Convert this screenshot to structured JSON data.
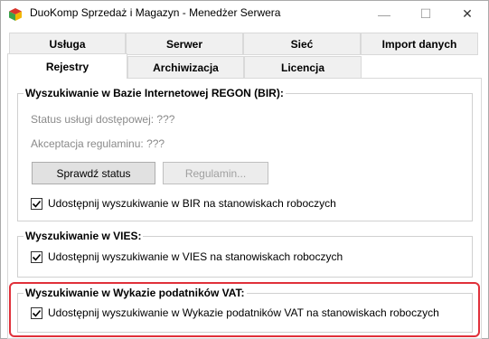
{
  "window": {
    "title": "DuoKomp Sprzedaż i Magazyn - Menedżer Serwera",
    "min_symbol": "—",
    "max_symbol": "☐",
    "close_symbol": "✕"
  },
  "tabs": {
    "row_top": [
      "Usługa",
      "Serwer",
      "Sieć",
      "Import danych"
    ],
    "row_bottom": [
      "Rejestry",
      "Archiwizacja",
      "Licencja"
    ],
    "active": "Rejestry"
  },
  "bir": {
    "title": "Wyszukiwanie w Bazie Internetowej REGON (BIR):",
    "status": "Status usługi dostępowej: ???",
    "terms": "Akceptacja regulaminu: ???",
    "check_button": "Sprawdź status",
    "terms_button": "Regulamin...",
    "checkbox_label": "Udostępnij wyszukiwanie w BIR na stanowiskach roboczych",
    "checked": true
  },
  "vies": {
    "title": "Wyszukiwanie w VIES:",
    "checkbox_label": "Udostępnij wyszukiwanie w VIES na stanowiskach roboczych",
    "checked": true
  },
  "vat": {
    "title": "Wyszukiwanie w Wykazie podatników VAT:",
    "checkbox_label": "Udostępnij wyszukiwanie w Wykazie podatników VAT na stanowiskach roboczych",
    "checked": true
  },
  "colors": {
    "highlight": "#e0303a",
    "icon_red": "#d9342b",
    "icon_green": "#3aa34a",
    "icon_yellow": "#f2b600"
  }
}
